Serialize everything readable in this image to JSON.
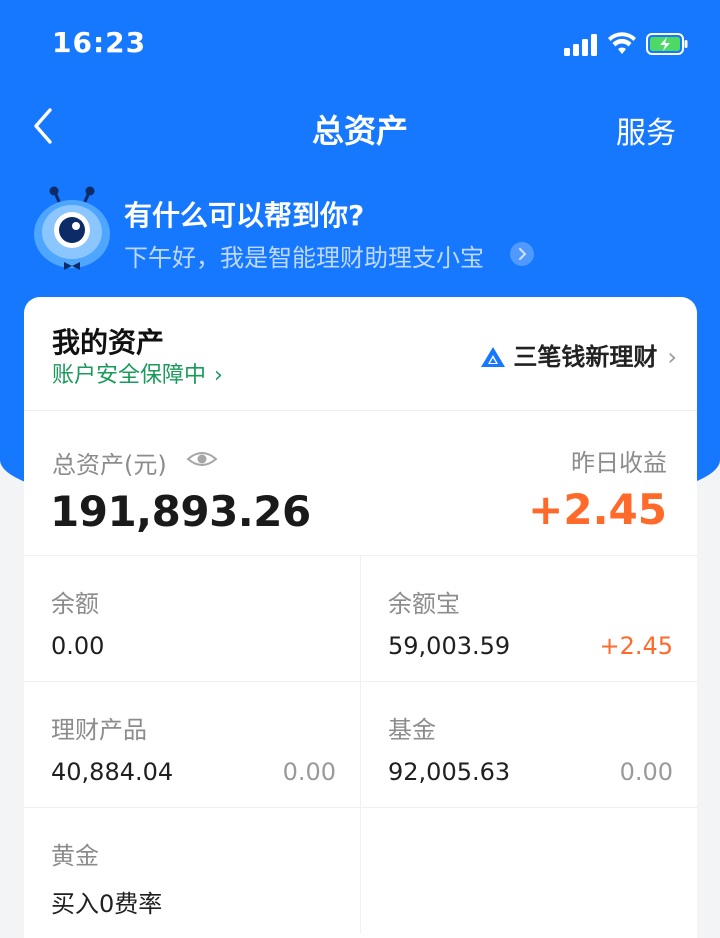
{
  "status_bar": {
    "time": "16:23"
  },
  "nav": {
    "title": "总资产",
    "action": "服务"
  },
  "assistant": {
    "title": "有什么可以帮到你?",
    "subtitle": "下午好，我是智能理财助理支小宝"
  },
  "card": {
    "heading": "我的资产",
    "security": "账户安全保障中",
    "brand": "三笔钱新理财",
    "total_label": "总资产(元)",
    "total_value": "191,893.26",
    "yesterday_label": "昨日收益",
    "yesterday_value": "+2.45",
    "items": [
      {
        "label": "余额",
        "value": "0.00",
        "change": ""
      },
      {
        "label": "余额宝",
        "value": "59,003.59",
        "change": "+2.45"
      },
      {
        "label": "理财产品",
        "value": "40,884.04",
        "change": "0.00"
      },
      {
        "label": "基金",
        "value": "92,005.63",
        "change": "0.00"
      },
      {
        "label": "黄金",
        "value": "买入0费率",
        "change": ""
      }
    ]
  },
  "colors": {
    "primary": "#1677ff",
    "profit": "#ff6a2b",
    "secure": "#1a9b5c"
  },
  "icons": [
    "back-icon",
    "eye-icon",
    "mascot-icon",
    "brand-logo-icon",
    "chevron-right-icon"
  ]
}
